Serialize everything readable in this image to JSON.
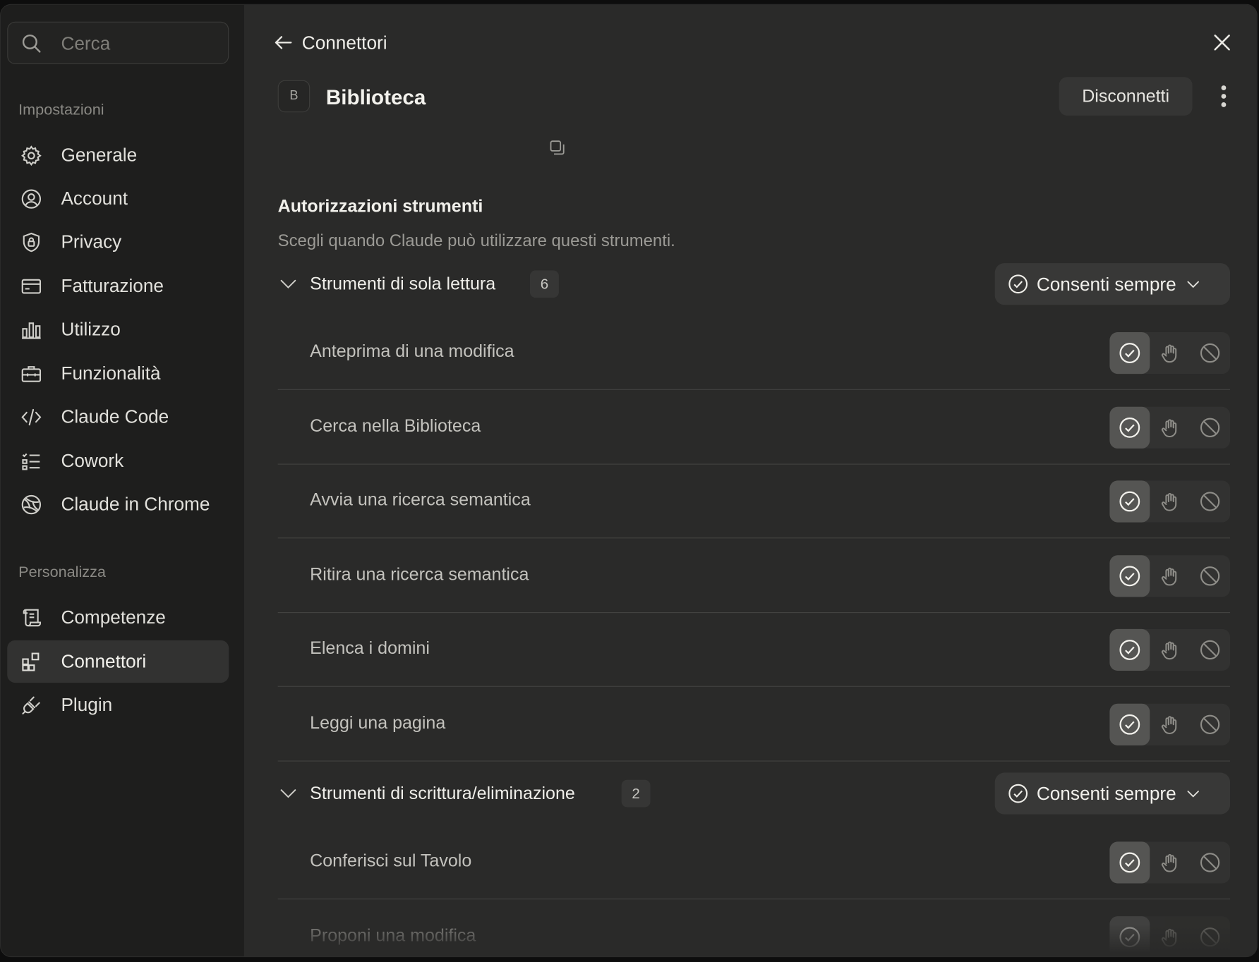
{
  "sidebar": {
    "search_placeholder": "Cerca",
    "section_settings": "Impostazioni",
    "section_personalize": "Personalizza",
    "items": [
      {
        "label": "Generale",
        "icon": "gear-icon"
      },
      {
        "label": "Account",
        "icon": "user-circle-icon"
      },
      {
        "label": "Privacy",
        "icon": "shield-lock-icon"
      },
      {
        "label": "Fatturazione",
        "icon": "credit-card-icon"
      },
      {
        "label": "Utilizzo",
        "icon": "bar-chart-icon"
      },
      {
        "label": "Funzionalità",
        "icon": "toolbox-icon"
      },
      {
        "label": "Claude Code",
        "icon": "code-icon"
      },
      {
        "label": "Cowork",
        "icon": "checklist-icon"
      },
      {
        "label": "Claude in Chrome",
        "icon": "globe-icon"
      }
    ],
    "personalize_items": [
      {
        "label": "Competenze",
        "icon": "scroll-icon"
      },
      {
        "label": "Connettori",
        "icon": "grid-plus-icon",
        "active": true
      },
      {
        "label": "Plugin",
        "icon": "plug-icon"
      }
    ]
  },
  "header": {
    "back_title": "Connettori"
  },
  "connector": {
    "badge_letter": "B",
    "name": "Biblioteca",
    "disconnect_label": "Disconnetti"
  },
  "permissions": {
    "title": "Autorizzazioni strumenti",
    "subtitle": "Scegli quando Claude può utilizzare questi strumenti.",
    "groups": [
      {
        "name": "Strumenti di sola lettura",
        "count": "6",
        "policy": "Consenti sempre",
        "tools": [
          {
            "name": "Anteprima di una modifica",
            "selected": "allow"
          },
          {
            "name": "Cerca nella Biblioteca",
            "selected": "allow"
          },
          {
            "name": "Avvia una ricerca semantica",
            "selected": "allow"
          },
          {
            "name": "Ritira una ricerca semantica",
            "selected": "allow"
          },
          {
            "name": "Elenca i domini",
            "selected": "allow"
          },
          {
            "name": "Leggi una pagina",
            "selected": "allow"
          }
        ]
      },
      {
        "name": "Strumenti di scrittura/eliminazione",
        "count": "2",
        "policy": "Consenti sempre",
        "tools": [
          {
            "name": "Conferisci sul Tavolo",
            "selected": "allow"
          },
          {
            "name": "Proponi una modifica",
            "selected": "allow"
          }
        ]
      }
    ]
  },
  "colors": {
    "sidebar_bg": "#1e1e1d",
    "main_bg": "#2a2a29",
    "active_nav": "#323231",
    "selected_segment": "#555553"
  }
}
